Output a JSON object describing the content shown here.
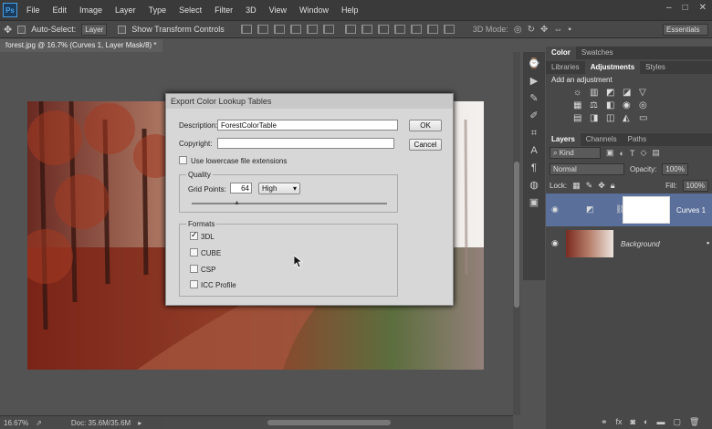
{
  "menubar": {
    "logo": "Ps",
    "items": [
      "File",
      "Edit",
      "Image",
      "Layer",
      "Type",
      "Select",
      "Filter",
      "3D",
      "View",
      "Window",
      "Help"
    ],
    "window_controls": [
      "–",
      "□",
      "✕"
    ]
  },
  "optionsbar": {
    "auto_select_label": "Auto-Select:",
    "auto_select_value": "Layer",
    "show_transform_label": "Show Transform Controls",
    "mode_3d_label": "3D Mode:",
    "workspace": "Essentials"
  },
  "document": {
    "tab_title": "forest.jpg @ 16.7% (Curves 1, Layer Mask/8) *",
    "close_glyph": "×"
  },
  "status": {
    "zoom": "16.67%",
    "doc": "Doc: 35.6M/35.6M"
  },
  "dialog": {
    "title": "Export Color Lookup Tables",
    "description_label": "Description:",
    "description_value": "ForestColorTable",
    "copyright_label": "Copyright:",
    "copyright_value": "",
    "lowercase_label": "Use lowercase file extensions",
    "lowercase_checked": false,
    "ok_label": "OK",
    "cancel_label": "Cancel",
    "quality_label": "Quality",
    "grid_points_label": "Grid Points:",
    "grid_points_value": "64",
    "quality_value": "High",
    "formats_label": "Formats",
    "formats": [
      {
        "label": "3DL",
        "checked": true
      },
      {
        "label": "CUBE",
        "checked": false
      },
      {
        "label": "CSP",
        "checked": false
      },
      {
        "label": "ICC Profile",
        "checked": false
      }
    ]
  },
  "panels": {
    "top_tabs": [
      "Color",
      "Swatches"
    ],
    "mid_tabs": [
      "Libraries",
      "Adjustments",
      "Styles"
    ],
    "add_adjustment": "Add an adjustment",
    "layer_tabs": [
      "Layers",
      "Channels",
      "Paths"
    ],
    "filter_kind": "Kind",
    "blend_mode": "Normal",
    "opacity_label": "Opacity:",
    "opacity_value": "100%",
    "lock_label": "Lock:",
    "fill_label": "Fill:",
    "fill_value": "100%",
    "layers": [
      {
        "name": "Curves 1",
        "visible": true,
        "selected": true
      },
      {
        "name": "Background",
        "visible": true,
        "selected": false
      }
    ],
    "footer_icons": [
      "link-icon",
      "fx-icon",
      "mask-icon",
      "adjustment-icon",
      "folder-icon",
      "new-layer-icon",
      "trash-icon"
    ]
  },
  "colors": {
    "app_bg": "#535353",
    "panel_bg": "#484848",
    "selected_layer": "#5a6f9a",
    "dialog_bg": "#d7d7d7"
  }
}
